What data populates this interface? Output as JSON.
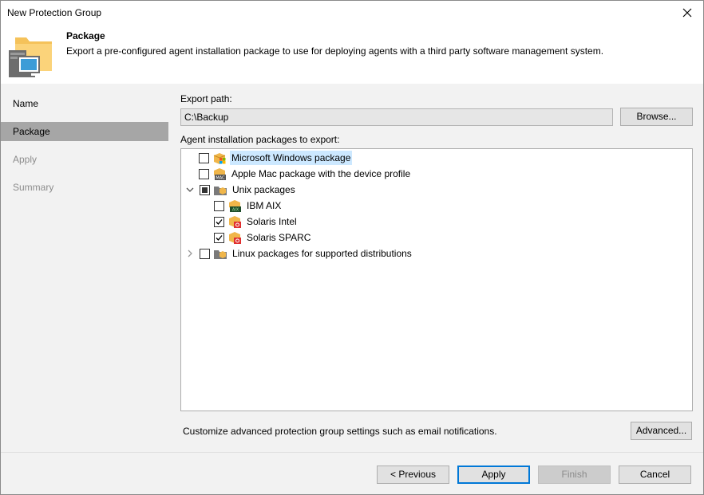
{
  "window": {
    "title": "New Protection Group"
  },
  "header": {
    "title": "Package",
    "description": "Export a pre-configured agent installation package to use for deploying agents with a third party software management system."
  },
  "sidebar": {
    "items": [
      {
        "label": "Name",
        "state": "normal"
      },
      {
        "label": "Package",
        "state": "active"
      },
      {
        "label": "Apply",
        "state": "disabled"
      },
      {
        "label": "Summary",
        "state": "disabled"
      }
    ]
  },
  "main": {
    "export_path_label": "Export path:",
    "export_path_value": "C:\\Backup",
    "browse_label": "Browse...",
    "packages_label": "Agent installation packages to export:",
    "tree": [
      {
        "label": "Microsoft Windows package",
        "checked": "no",
        "icon": "windows-package-icon",
        "selected": true
      },
      {
        "label": "Apple Mac package with the device profile",
        "checked": "no",
        "icon": "mac-package-icon"
      },
      {
        "label": "Unix packages",
        "checked": "partial",
        "icon": "unix-folder-icon",
        "expanded": true
      },
      {
        "label": "IBM AIX",
        "checked": "no",
        "icon": "aix-package-icon"
      },
      {
        "label": "Solaris Intel",
        "checked": "yes",
        "icon": "solaris-package-icon"
      },
      {
        "label": "Solaris SPARC",
        "checked": "yes",
        "icon": "solaris-package-icon"
      },
      {
        "label": "Linux packages for supported distributions",
        "checked": "no",
        "icon": "linux-folder-icon",
        "expanded": false
      }
    ],
    "advanced_text": "Customize advanced protection group settings such as email notifications.",
    "advanced_button": "Advanced..."
  },
  "footer": {
    "previous": "< Previous",
    "apply": "Apply",
    "finish": "Finish",
    "cancel": "Cancel"
  },
  "colors": {
    "selection": "#cce8ff",
    "active_nav": "#a6a6a6",
    "focus_border": "#0078d7"
  }
}
